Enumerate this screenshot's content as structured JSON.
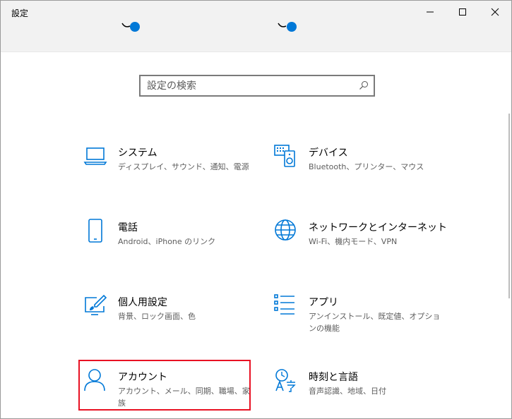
{
  "window": {
    "title": "設定"
  },
  "search": {
    "placeholder": "設定の検索"
  },
  "tiles": [
    {
      "title": "システム",
      "description": "ディスプレイ、サウンド、通知、電源",
      "icon": "laptop-icon"
    },
    {
      "title": "デバイス",
      "description": "Bluetooth、プリンター、マウス",
      "icon": "devices-icon"
    },
    {
      "title": "電話",
      "description": "Android、iPhone のリンク",
      "icon": "phone-icon"
    },
    {
      "title": "ネットワークとインターネット",
      "description": "Wi-Fi、機内モード、VPN",
      "icon": "globe-icon"
    },
    {
      "title": "個人用設定",
      "description": "背景、ロック画面、色",
      "icon": "personalization-icon"
    },
    {
      "title": "アプリ",
      "description": "アンインストール、既定値、オプションの機能",
      "icon": "apps-list-icon"
    },
    {
      "title": "アカウント",
      "description": "アカウント、メール、同期、職場、家族",
      "icon": "person-icon"
    },
    {
      "title": "時刻と言語",
      "description": "音声認識、地域、日付",
      "icon": "time-language-icon"
    }
  ],
  "colors": {
    "accent": "#0078d7",
    "highlight_border": "#e81123",
    "titlebar_bg": "#f2f2f2"
  }
}
